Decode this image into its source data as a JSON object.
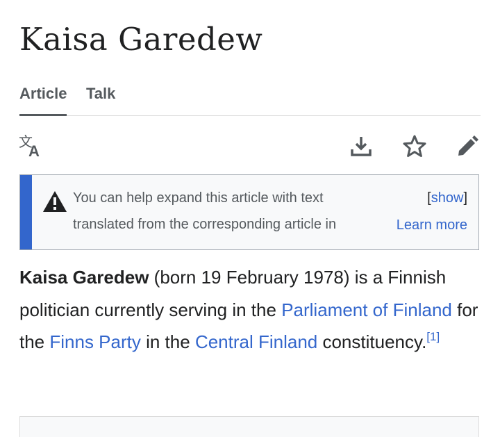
{
  "article": {
    "title": "Kaisa Garedew"
  },
  "tabs": [
    {
      "label": "Article",
      "selected": true
    },
    {
      "label": "Talk",
      "selected": false
    }
  ],
  "toolbar": {
    "icons": [
      "translate-icon",
      "download-icon",
      "star-icon",
      "edit-icon"
    ]
  },
  "notice": {
    "line1": "You can help expand this article with text",
    "line2": "translated from the corresponding article in",
    "show_open": "[",
    "show_label": "show",
    "show_close": "]",
    "learn_more": "Learn more"
  },
  "body": {
    "subject": "Kaisa Garedew",
    "text1": " (born 19 February 1978) is a Finnish politician currently serving in the ",
    "link1": "Parliament of Finland",
    "text2": " for the ",
    "link2": "Finns Party",
    "text3": " in the ",
    "link3": "Central Finland",
    "text4": " constituency.",
    "ref": "[1]"
  },
  "colors": {
    "link": "#3366cc",
    "notice_bar": "#3366cc",
    "notice_bg": "#f8f9fa",
    "text": "#202122"
  }
}
